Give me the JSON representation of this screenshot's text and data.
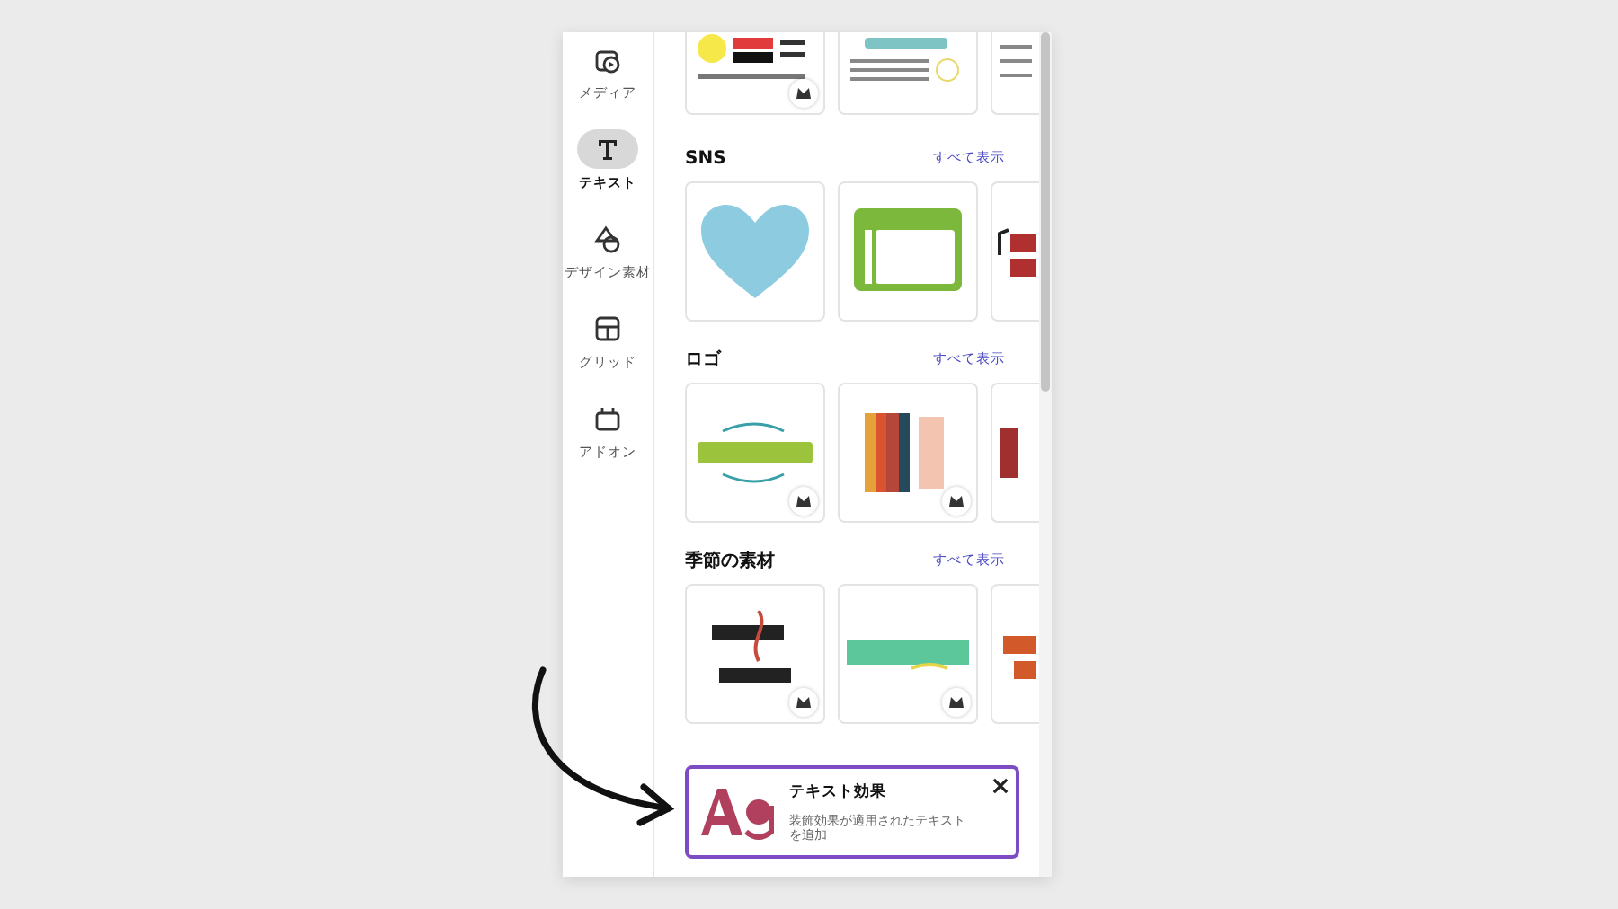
{
  "sidebar": {
    "items": [
      {
        "label": "メディア",
        "selected": false
      },
      {
        "label": "テキスト",
        "selected": true
      },
      {
        "label": "デザイン素材",
        "selected": false
      },
      {
        "label": "グリッド",
        "selected": false
      },
      {
        "label": "アドオン",
        "selected": false
      }
    ]
  },
  "top_row": {
    "cards": [
      {
        "kind": "ad",
        "premium": true
      },
      {
        "kind": "checklist",
        "premium": false
      },
      {
        "kind": "list",
        "premium": false
      }
    ]
  },
  "sections": [
    {
      "title": "SNS",
      "see_all": "すべて表示",
      "cards": [
        {
          "kind": "heart",
          "premium": false
        },
        {
          "kind": "packlist",
          "premium": false
        },
        {
          "kind": "music",
          "premium": false
        }
      ]
    },
    {
      "title": "ロゴ",
      "see_all": "すべて表示",
      "cards": [
        {
          "kind": "foodsource",
          "premium": true
        },
        {
          "kind": "books",
          "premium": true
        },
        {
          "kind": "logo",
          "premium": false
        }
      ]
    },
    {
      "title": "季節の素材",
      "see_all": "すべて表示",
      "cards": [
        {
          "kind": "merry",
          "premium": true
        },
        {
          "kind": "summer",
          "premium": true
        },
        {
          "kind": "season",
          "premium": false
        }
      ]
    }
  ],
  "promo": {
    "title": "テキスト効果",
    "description": "装飾効果が適用されたテキストを追加"
  }
}
